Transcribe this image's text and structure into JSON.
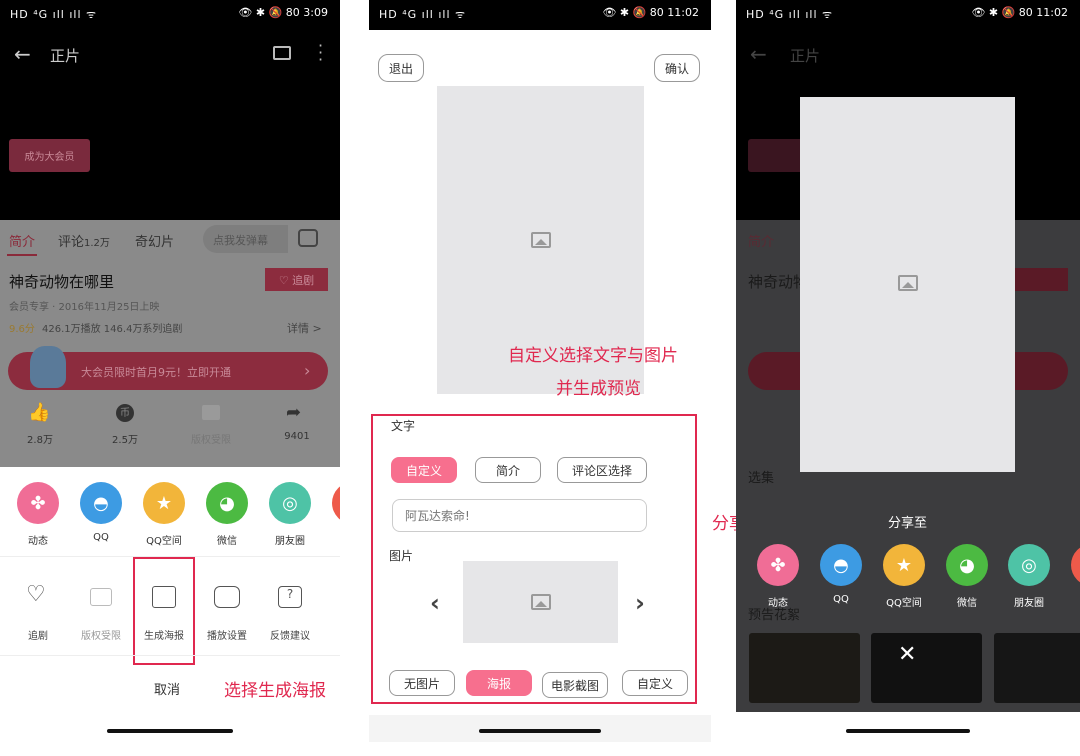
{
  "status": {
    "left": "HD ⁴G ıll ıll ᯤ",
    "right1": "👁 ✱ 🔕 80 3:09",
    "right2": "👁 ✱ 🔕 80 11:02",
    "right3": "👁 ✱ 🔕 80 11:02"
  },
  "player": {
    "title": "正片",
    "vip_button": "成为大会员"
  },
  "tabs": [
    {
      "label": "简介"
    },
    {
      "label": "评论",
      "count": "1.2万"
    },
    {
      "label": "奇幻片"
    }
  ],
  "danmaku_placeholder": "点我发弹幕",
  "movie": {
    "title": "神奇动物在哪里",
    "follow": "♡ 追剧",
    "meta": "会员专享 · 2016年11月25日上映",
    "score": "9.6分",
    "stats": "426.1万播放  146.4万系列追剧",
    "details": "详情 >"
  },
  "banner": "大会员限时首月9元！立即开通",
  "actions": [
    {
      "icon": "thumbs-up-icon",
      "label": "2.8万"
    },
    {
      "icon": "coin-icon",
      "label": "2.5万"
    },
    {
      "icon": "download-icon",
      "label": "版权受限"
    },
    {
      "icon": "share-icon",
      "label": "9401"
    }
  ],
  "share": {
    "title": "分享至",
    "targets": [
      {
        "label": "动态",
        "icon": "pinwheel-icon",
        "color": "#f06d96"
      },
      {
        "label": "QQ",
        "icon": "qq-penguin-icon",
        "color": "#3d9be3"
      },
      {
        "label": "QQ空间",
        "icon": "qzone-star-icon",
        "color": "#f2b53a"
      },
      {
        "label": "微信",
        "icon": "wechat-icon",
        "color": "#4cba42"
      },
      {
        "label": "朋友圈",
        "icon": "moments-icon",
        "color": "#4ec3a6"
      }
    ]
  },
  "tools": [
    {
      "label": "追剧",
      "icon": "heart-icon"
    },
    {
      "label": "版权受限",
      "icon": "download-icon"
    },
    {
      "label": "生成海报",
      "icon": "image-icon"
    },
    {
      "label": "播放设置",
      "icon": "settings-icon"
    },
    {
      "label": "反馈建议",
      "icon": "feedback-icon"
    }
  ],
  "cancel": "取消",
  "poster": {
    "exit": "退出",
    "confirm": "确认",
    "text_label": "文字",
    "text_options": [
      "自定义",
      "简介",
      "评论区选择"
    ],
    "text_selected": "自定义",
    "input_placeholder": "阿瓦达索命!",
    "image_label": "图片",
    "image_options": [
      "无图片",
      "海报",
      "电影截图",
      "自定义"
    ],
    "image_selected": "海报"
  },
  "panel3": {
    "episodes": "选集",
    "trailers": "预告花絮"
  },
  "annotations": {
    "a1": "选择生成海报",
    "a2": "自定义选择文字与图片",
    "a3": "并生成预览",
    "a4": "分享海报"
  },
  "colors": {
    "accent": "#f76f8e",
    "annotation": "#e0284f"
  }
}
